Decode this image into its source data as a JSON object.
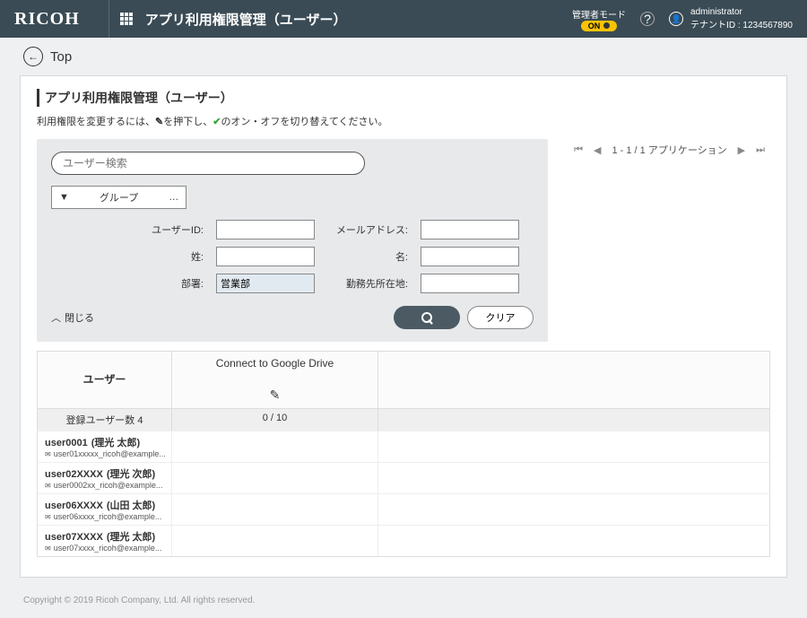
{
  "header": {
    "brand": "RICOH",
    "title": "アプリ利用権限管理（ユーザー）",
    "adminModeLabel": "管理者モード",
    "adminOn": "ON",
    "userName": "administrator",
    "tenantLabel": "テナントID : 1234567890"
  },
  "crumb": {
    "top": "Top"
  },
  "page": {
    "title": "アプリ利用権限管理（ユーザー）",
    "hintPre": "利用権限を変更するには、",
    "hintMid": "を押下し、",
    "hintPost": "のオン・オフを切り替えてください。",
    "search": {
      "placeholder": "ユーザー検索"
    },
    "groupLabel": "グループ",
    "fields": {
      "userId": "ユーザーID:",
      "mail": "メールアドレス:",
      "lastName": "姓:",
      "firstName": "名:",
      "dept": "部署:",
      "location": "勤務先所在地:",
      "deptValue": "営業部"
    },
    "closeLabel": "閉じる",
    "clearLabel": "クリア",
    "pager": "1 - 1 / 1 アプリケーション"
  },
  "table": {
    "userHeader": "ユーザー",
    "appHeader": "Connect to Google Drive",
    "countLabel": "登録ユーザー数 4",
    "countApp": "0 / 10",
    "rows": [
      {
        "id": "user0001",
        "name": "(理光 太郎)",
        "mail": "user01xxxxx_ricoh@example..."
      },
      {
        "id": "user02XXXX",
        "name": "(理光 次郎)",
        "mail": "user0002xx_ricoh@example..."
      },
      {
        "id": "user06XXXX",
        "name": "(山田 太郎)",
        "mail": "user06xxxx_ricoh@example..."
      },
      {
        "id": "user07XXXX",
        "name": "(理光 太郎)",
        "mail": "user07xxxx_ricoh@example..."
      }
    ]
  },
  "footer": "Copyright © 2019 Ricoh Company, Ltd. All rights reserved."
}
